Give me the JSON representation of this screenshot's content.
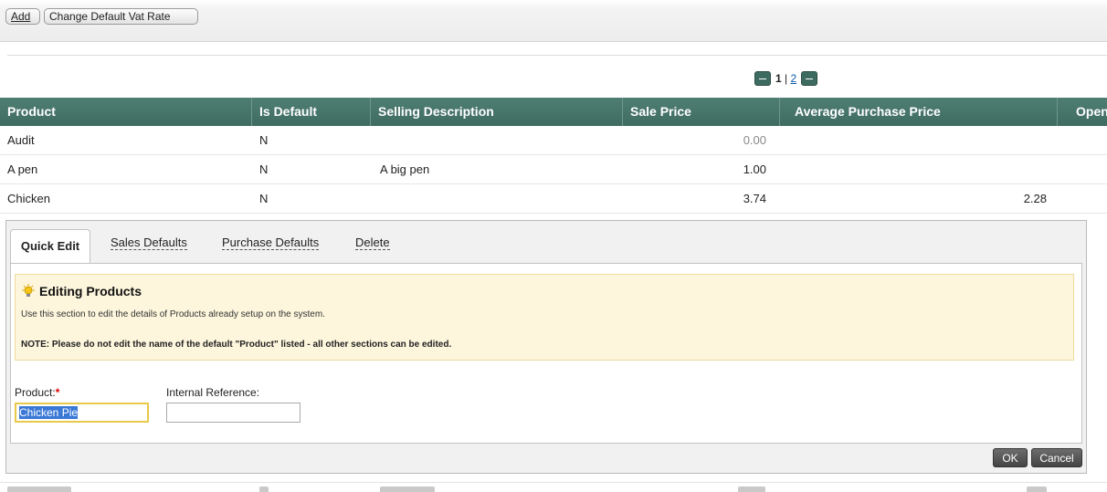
{
  "toolbar": {
    "add_label": "Add",
    "vat_label": "Change Default Vat Rate"
  },
  "pager": {
    "current": "1",
    "separator": "|",
    "next_page": "2"
  },
  "table": {
    "columns": [
      "Product",
      "Is Default",
      "Selling Description",
      "Sale Price",
      "Average Purchase Price",
      "Open"
    ],
    "rows": [
      {
        "product": "Audit",
        "is_default": "N",
        "description": "",
        "sale_price": "0.00",
        "avg_purchase": ""
      },
      {
        "product": "A pen",
        "is_default": "N",
        "description": "A big pen",
        "sale_price": "1.00",
        "avg_purchase": ""
      },
      {
        "product": "Chicken",
        "is_default": "N",
        "description": "",
        "sale_price": "3.74",
        "avg_purchase": "2.28"
      }
    ]
  },
  "tabs": [
    {
      "label": "Quick Edit",
      "active": true
    },
    {
      "label": "Sales Defaults",
      "active": false
    },
    {
      "label": "Purchase Defaults",
      "active": false
    },
    {
      "label": "Delete",
      "active": false
    }
  ],
  "info": {
    "icon": "lightbulb-icon",
    "title": "Editing Products",
    "text": "Use this section to edit the details of Products already setup on the system.",
    "note": "NOTE: Please do not edit the name of the default \"Product\" listed - all other sections can be edited."
  },
  "form": {
    "product_label": "Product:",
    "product_required": "*",
    "product_value": "Chicken Pie",
    "ref_label": "Internal Reference:",
    "ref_value": ""
  },
  "footer": {
    "ok_label": "OK",
    "cancel_label": "Cancel"
  },
  "colors": {
    "header_green": "#4a786c",
    "info_bg": "#fdf6dd",
    "focus_border": "#e9c84a"
  }
}
